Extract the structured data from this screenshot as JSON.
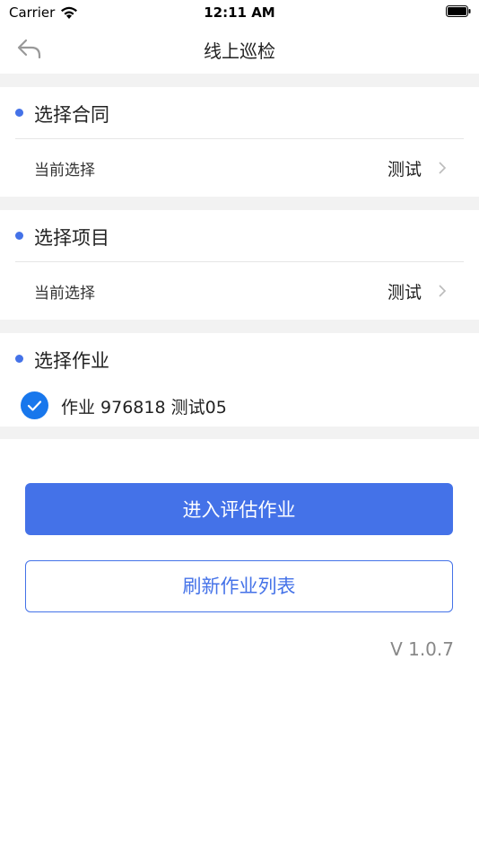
{
  "status_bar": {
    "carrier": "Carrier",
    "time": "12:11 AM"
  },
  "nav": {
    "title": "线上巡检",
    "back_icon": "back-arrow-icon"
  },
  "sections": {
    "contract": {
      "title": "选择合同",
      "row_label": "当前选择",
      "row_value": "测试"
    },
    "project": {
      "title": "选择项目",
      "row_label": "当前选择",
      "row_value": "测试"
    },
    "job": {
      "title": "选择作业",
      "selected_job": "作业 976818 测试05",
      "checked": true
    }
  },
  "buttons": {
    "enter": "进入评估作业",
    "refresh": "刷新作业列表"
  },
  "version": "V 1.0.7",
  "colors": {
    "accent": "#4472e8",
    "check": "#1877ec",
    "gap": "#f2f2f2"
  }
}
